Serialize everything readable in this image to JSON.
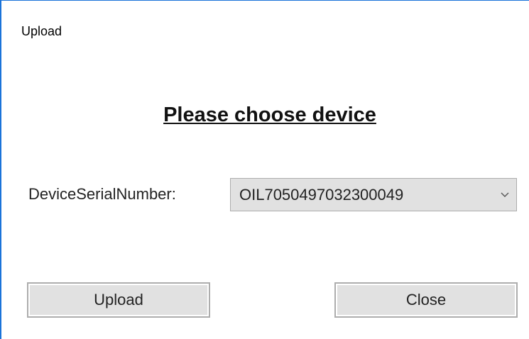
{
  "window": {
    "title": "Upload"
  },
  "main": {
    "heading": "Please choose device",
    "device_label": "DeviceSerialNumber:",
    "device_select": {
      "selected_value": "OIL7050497032300049",
      "icon": "chevron-down-icon"
    }
  },
  "buttons": {
    "upload_label": "Upload",
    "close_label": "Close"
  },
  "colors": {
    "frame_accent": "#1a73d9",
    "button_bg": "#e1e1e1",
    "button_border": "#adadad"
  }
}
